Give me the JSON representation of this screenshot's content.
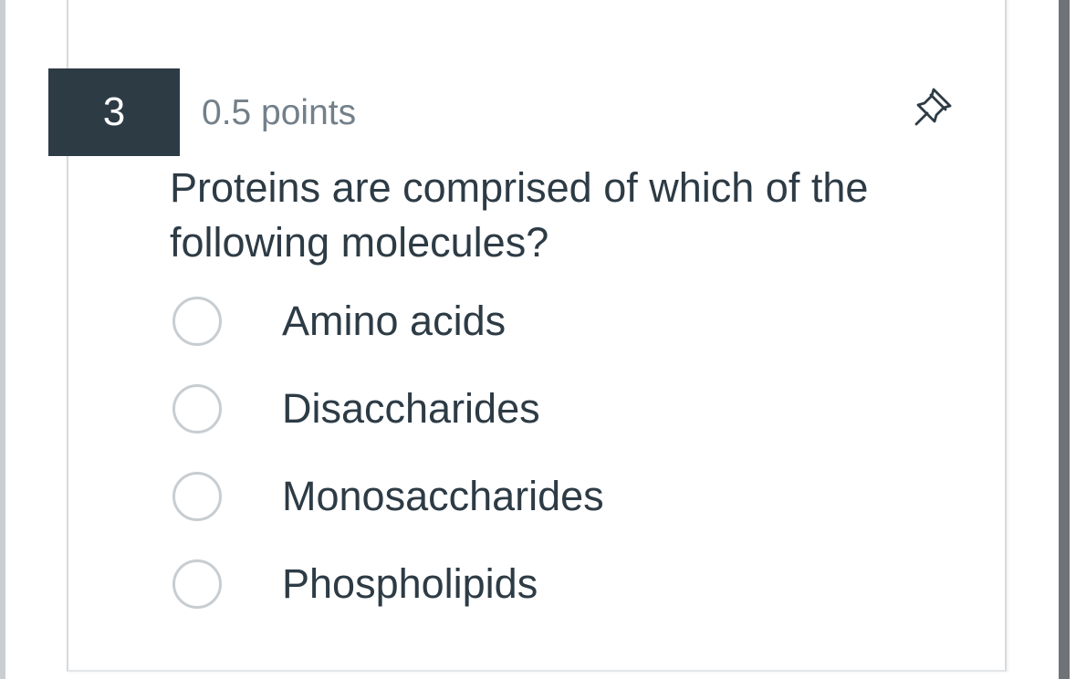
{
  "question": {
    "number": "3",
    "points": "0.5 points",
    "text": "Proteins are comprised of which of the following molecules?",
    "pin_icon": "pushpin-icon",
    "options": [
      {
        "label": "Amino acids"
      },
      {
        "label": "Disaccharides"
      },
      {
        "label": "Monosaccharides"
      },
      {
        "label": "Phospholipids"
      }
    ]
  },
  "colors": {
    "badge_background": "#2d3b45",
    "text": "#2d3b45",
    "muted_text": "#73808a",
    "radio_border": "#c7cdd1"
  }
}
